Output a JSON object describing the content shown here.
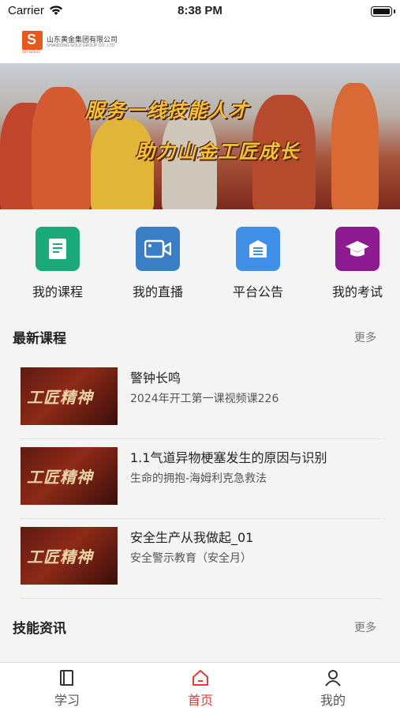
{
  "status": {
    "carrier": "Carrier",
    "time": "8:38 PM"
  },
  "logo": {
    "name": "山东黄金集团有限公司",
    "en": "SHANDONG GOLD GROUP CO., LTD.",
    "mark_sub": "SD-GOLD"
  },
  "banner": {
    "line1": "服务一线技能人才",
    "line2": "助力山金工匠成长"
  },
  "quick_links": [
    {
      "label": "我的课程",
      "icon": "book-icon",
      "color": "#1aa979"
    },
    {
      "label": "我的直播",
      "icon": "video-camera-icon",
      "color": "#3a7fc5"
    },
    {
      "label": "平台公告",
      "icon": "announcement-icon",
      "color": "#3f8fe6"
    },
    {
      "label": "我的考试",
      "icon": "graduation-cap-icon",
      "color": "#8e1a91"
    }
  ],
  "latest_courses": {
    "title": "最新课程",
    "more": "更多",
    "items": [
      {
        "thumb_text": "工匠精神",
        "title": "警钟长鸣",
        "subtitle": "2024年开工第一课视频课226"
      },
      {
        "thumb_text": "工匠精神",
        "title": "1.1气道异物梗塞发生的原因与识别",
        "subtitle": "生命的拥抱-海姆利克急救法"
      },
      {
        "thumb_text": "工匠精神",
        "title": "安全生产从我做起_01",
        "subtitle": "安全警示教育（安全月）"
      }
    ]
  },
  "skills_news": {
    "title": "技能资讯",
    "more": "更多"
  },
  "tabs": [
    {
      "label": "学习",
      "icon": "book-stack-icon",
      "active": false
    },
    {
      "label": "首页",
      "icon": "home-icon",
      "active": true
    },
    {
      "label": "我的",
      "icon": "user-icon",
      "active": false
    }
  ],
  "colors": {
    "active_tab": "#e53935",
    "inactive_tab": "#555555"
  }
}
